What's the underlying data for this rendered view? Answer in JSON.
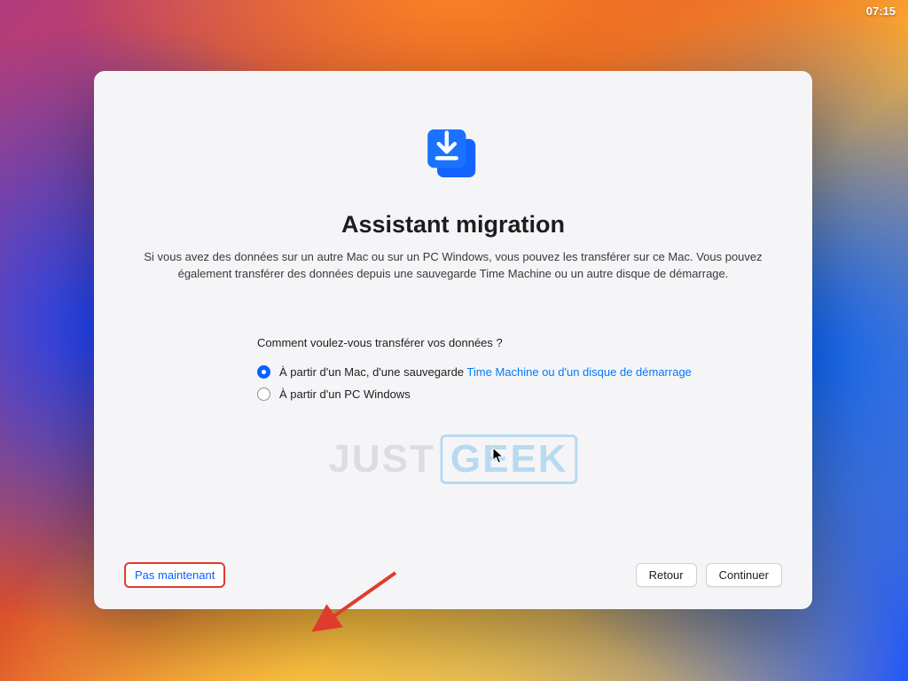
{
  "menubar": {
    "clock": "07:15"
  },
  "panel": {
    "title": "Assistant migration",
    "description": "Si vous avez des données sur un autre Mac ou sur un PC Windows, vous pouvez les transférer sur ce Mac. Vous pouvez également transférer des données depuis une sauvegarde Time Machine ou un autre disque de démarrage.",
    "question": "Comment voulez-vous transférer vos données ?",
    "options": [
      {
        "prefix": "À partir d'un Mac, d'une sauvegarde ",
        "link": "Time Machine ou d'un disque de démarrage",
        "selected": true
      },
      {
        "prefix": "À partir d'un PC Windows",
        "link": "",
        "selected": false
      }
    ],
    "buttons": {
      "not_now": "Pas maintenant",
      "back": "Retour",
      "continue": "Continuer"
    }
  },
  "watermark": {
    "left": "JUST",
    "right": "GEEK"
  },
  "icons": {
    "migration": "migration-icon"
  },
  "colors": {
    "accent": "#0a60ff",
    "link": "#007aff",
    "annotation": "#e03b2f"
  }
}
